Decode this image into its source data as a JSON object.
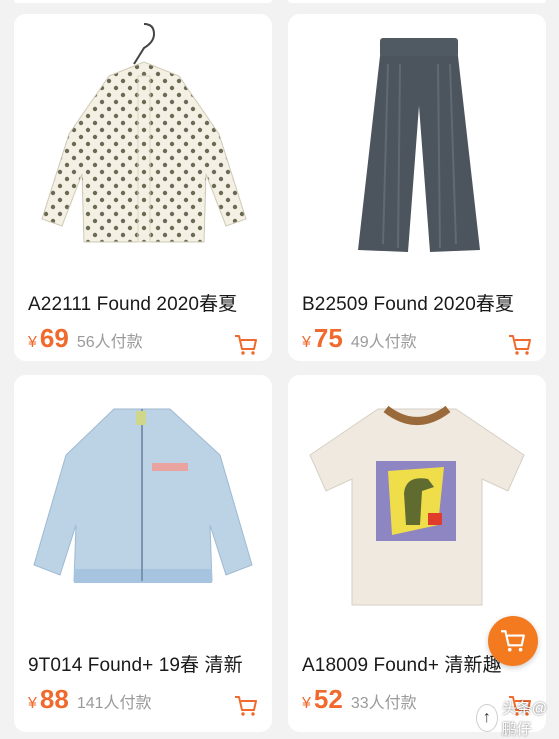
{
  "products": [
    {
      "title": "A22111 Found 2020春夏",
      "currency": "¥",
      "price": "69",
      "paid": "56人付款",
      "image": "polka-dot-blouse-image"
    },
    {
      "title": "B22509 Found 2020春夏",
      "currency": "¥",
      "price": "75",
      "paid": "49人付款",
      "image": "grey-wide-pants-image"
    },
    {
      "title": "9T014 Found+ 19春 清新",
      "currency": "¥",
      "price": "88",
      "paid": "141人付款",
      "image": "light-blue-jacket-image"
    },
    {
      "title": "A18009 Found+ 清新趣",
      "currency": "¥",
      "price": "52",
      "paid": "33人付款",
      "image": "dinosaur-tshirt-image"
    }
  ],
  "accent_color": "#ef6a2c",
  "fab_color": "#f47a1f",
  "watermark": {
    "arrow": "↑",
    "text": "头条@鹏仔"
  }
}
